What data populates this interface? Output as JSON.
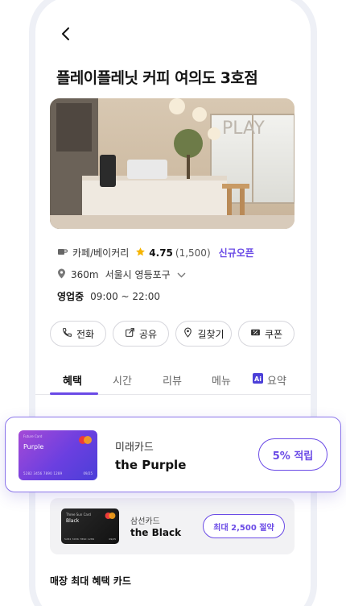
{
  "store": {
    "title": "플레이플레닛 커피 여의도 3호점",
    "category": "카페/베이커리",
    "rating": "4.75",
    "review_count": "(1,500)",
    "badge": "신규오픈",
    "distance": "360m",
    "address": "서울시 영등포구",
    "hours_label": "영업중",
    "hours": "09:00 ~ 22:00",
    "photo_sign": "PLAY"
  },
  "actions": [
    {
      "label": "전화",
      "icon": "phone-icon"
    },
    {
      "label": "공유",
      "icon": "share-icon"
    },
    {
      "label": "길찾기",
      "icon": "directions-icon"
    },
    {
      "label": "쿠폰",
      "icon": "coupon-icon"
    }
  ],
  "tabs": [
    {
      "label": "혜택",
      "active": true
    },
    {
      "label": "시간",
      "active": false
    },
    {
      "label": "리뷰",
      "active": false
    },
    {
      "label": "메뉴",
      "active": false
    },
    {
      "label": "요약",
      "active": false,
      "icon": "ai-icon"
    }
  ],
  "highlight_card": {
    "issuer": "미래카드",
    "name": "the Purple",
    "benefit": "5% 적립",
    "card_brand": "Future Card",
    "card_label": "Purple",
    "card_number": "5282 3456 7890 1289",
    "card_expiry": "09/25",
    "color": "#6b3fe0"
  },
  "secondary_card": {
    "issuer": "삼선카드",
    "name": "the Black",
    "benefit": "최대 2,500 절약",
    "card_brand": "Three Sun Card",
    "card_label": "Black",
    "card_number": "5282 3456 7890 1289",
    "card_expiry": "09/25"
  },
  "section_title": "매장 최대 혜택 카드",
  "colors": {
    "accent": "#6a4ae6",
    "star": "#f5b400"
  }
}
